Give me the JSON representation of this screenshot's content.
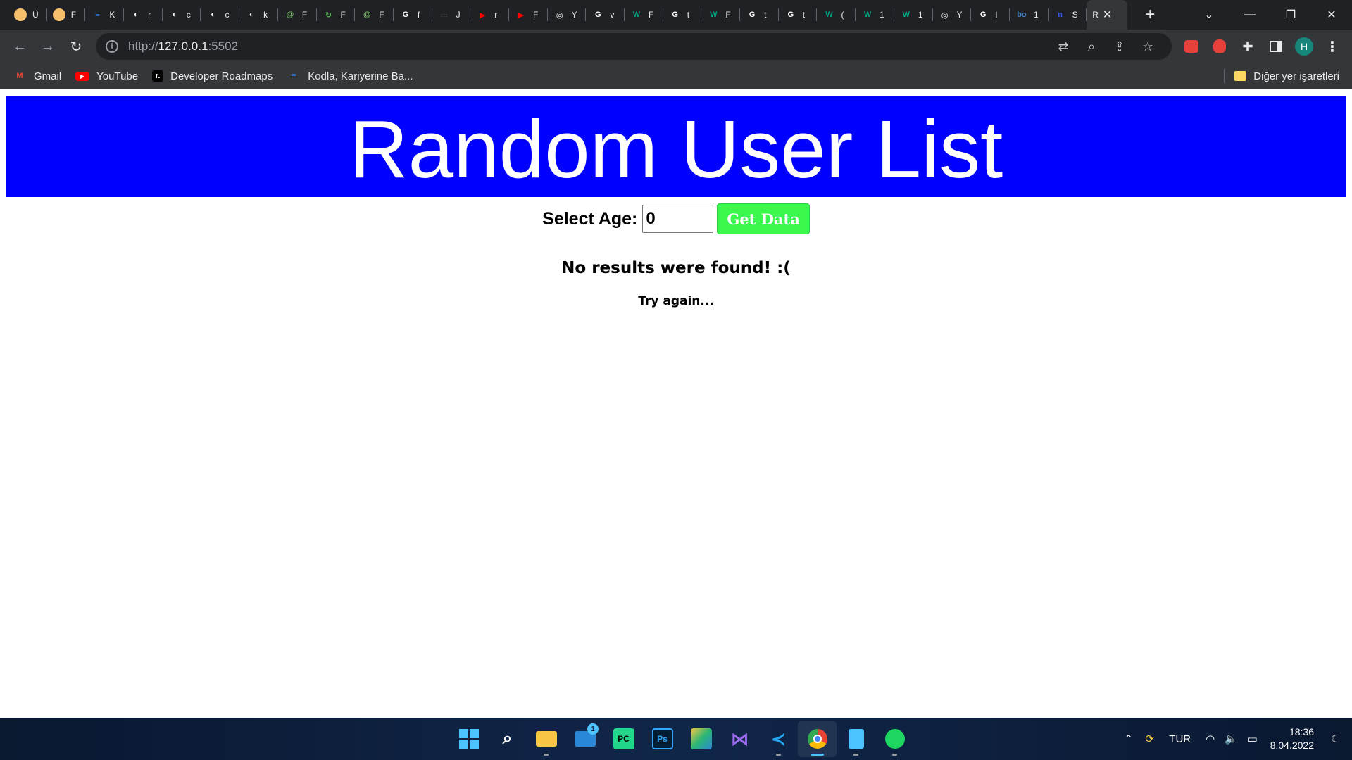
{
  "browser": {
    "tabs": [
      {
        "letter": "Ü",
        "color": "#f6bf6b",
        "glyph": ""
      },
      {
        "letter": "F",
        "color": "#f6bf6b",
        "glyph": ""
      },
      {
        "letter": "K",
        "color": "#2a7de1",
        "glyph": "≡"
      },
      {
        "letter": "r",
        "color": "#ffffff",
        "glyph": "◐"
      },
      {
        "letter": "c",
        "color": "#ffffff",
        "glyph": "◐"
      },
      {
        "letter": "c",
        "color": "#ffffff",
        "glyph": "◐"
      },
      {
        "letter": "k",
        "color": "#ffffff",
        "glyph": "◐"
      },
      {
        "letter": "F",
        "color": "#7ec36c",
        "glyph": "@"
      },
      {
        "letter": "F",
        "color": "#4fb848",
        "glyph": "↻"
      },
      {
        "letter": "F",
        "color": "#7ec36c",
        "glyph": "@"
      },
      {
        "letter": "f",
        "color": "#ffffff",
        "glyph": "G"
      },
      {
        "letter": "J",
        "color": "#3c3c3c",
        "glyph": "▭"
      },
      {
        "letter": "r",
        "color": "#ff0000",
        "glyph": "▶"
      },
      {
        "letter": "F",
        "color": "#ff0000",
        "glyph": "▶"
      },
      {
        "letter": "Y",
        "color": "#ffffff",
        "glyph": "◎"
      },
      {
        "letter": "v",
        "color": "#ffffff",
        "glyph": "G"
      },
      {
        "letter": "F",
        "color": "#00a884",
        "glyph": "W"
      },
      {
        "letter": "t",
        "color": "#ffffff",
        "glyph": "G"
      },
      {
        "letter": "F",
        "color": "#00a884",
        "glyph": "W"
      },
      {
        "letter": "t",
        "color": "#ffffff",
        "glyph": "G"
      },
      {
        "letter": "t",
        "color": "#ffffff",
        "glyph": "G"
      },
      {
        "letter": "(",
        "color": "#00a884",
        "glyph": "W"
      },
      {
        "letter": "1",
        "color": "#00a884",
        "glyph": "W"
      },
      {
        "letter": "1",
        "color": "#00a884",
        "glyph": "W"
      },
      {
        "letter": "Y",
        "color": "#ffffff",
        "glyph": "◎"
      },
      {
        "letter": "I",
        "color": "#ffffff",
        "glyph": "G"
      },
      {
        "letter": "1",
        "color": "#4a84c4",
        "glyph": "bo"
      },
      {
        "letter": "S",
        "color": "#2b5ed8",
        "glyph": "n"
      }
    ],
    "active_tab": {
      "letter": "R",
      "close": "✕"
    },
    "new_tab": "+",
    "window_controls": {
      "chevron": "⌄",
      "minimize": "—",
      "restore": "❐",
      "close": "✕"
    },
    "url_host": "http://127.0.0.1",
    "url_host_bold": "127.0.0.1",
    "url_scheme": "http://",
    "url_port": ":5502",
    "avatar_letter": "H",
    "bookmarks": [
      {
        "label": "Gmail",
        "icon": "gmail-icon",
        "glyph": "M",
        "color": "#ea4335"
      },
      {
        "label": "YouTube",
        "icon": "youtube-icon",
        "glyph": "▶",
        "color": "#ff0000"
      },
      {
        "label": "Developer Roadmaps",
        "icon": "roadmap-icon",
        "glyph": "r.",
        "color": "#000000"
      },
      {
        "label": "Kodla, Kariyerine Ba...",
        "icon": "kodla-icon",
        "glyph": "≡",
        "color": "#2a7de1"
      }
    ],
    "other_bookmarks": "Diğer yer işaretleri"
  },
  "page": {
    "title": "Random User List",
    "age_label": "Select Age:",
    "age_value": "0",
    "button_label": "Get Data",
    "message": "No results were found! :(",
    "submessage": "Try again..."
  },
  "taskbar": {
    "language": "TUR",
    "time": "18:36",
    "date": "8.04.2022",
    "mail_badge": "1"
  },
  "colors": {
    "banner": "#0000ff",
    "button": "#3cf84e"
  }
}
